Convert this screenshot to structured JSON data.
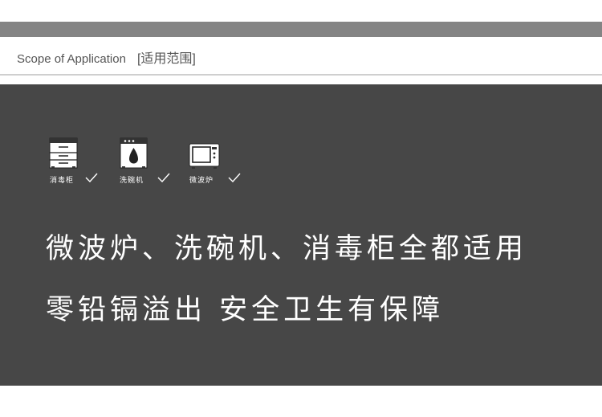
{
  "header": {
    "title": "Scope of Application",
    "subtitle": "[适用范围]"
  },
  "appliances": [
    {
      "label": "消毒柜",
      "icon": "sterilizer-cabinet-icon"
    },
    {
      "label": "洗碗机",
      "icon": "dishwasher-icon"
    },
    {
      "label": "微波炉",
      "icon": "microwave-icon"
    }
  ],
  "headline": {
    "line1": "微波炉、洗碗机、消毒柜全都适用",
    "line2": "零铅镉溢出  安全卫生有保障"
  },
  "colors": {
    "top_bar": "#848484",
    "panel_bg": "#474747",
    "text_light": "#ffffff",
    "header_text": "#555555"
  }
}
